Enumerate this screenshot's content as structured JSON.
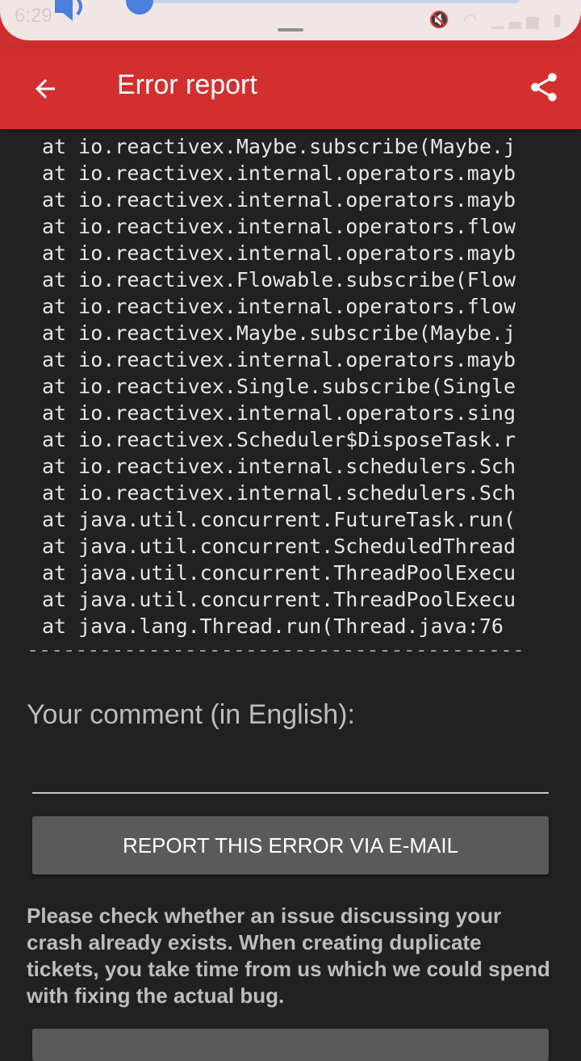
{
  "status_bar": {
    "time": "6:29",
    "volume_level": 0.03
  },
  "app_bar": {
    "title": "Error report",
    "back_icon": "arrow-back-icon",
    "share_icon": "share-icon"
  },
  "stack_trace": {
    "lines": [
      "at io.reactivex.Maybe.subscribe(Maybe.j",
      "at io.reactivex.internal.operators.mayb",
      "at io.reactivex.internal.operators.mayb",
      "at io.reactivex.internal.operators.flow",
      "at io.reactivex.internal.operators.mayb",
      "at io.reactivex.Flowable.subscribe(Flow",
      "at io.reactivex.internal.operators.flow",
      "at io.reactivex.Maybe.subscribe(Maybe.j",
      "at io.reactivex.internal.operators.mayb",
      "at io.reactivex.Single.subscribe(Single",
      "at io.reactivex.internal.operators.sing",
      "at io.reactivex.Scheduler$DisposeTask.r",
      "at io.reactivex.internal.schedulers.Sch",
      "at io.reactivex.internal.schedulers.Sch",
      "at java.util.concurrent.FutureTask.run(",
      "at java.util.concurrent.ScheduledThread",
      "at java.util.concurrent.ThreadPoolExecu",
      "at java.util.concurrent.ThreadPoolExecu",
      "at java.lang.Thread.run(Thread.java:76"
    ],
    "divider": "-----------------------------------------"
  },
  "comment": {
    "label": "Your comment (in English):",
    "value": ""
  },
  "report_button": {
    "label": "REPORT THIS ERROR VIA E-MAIL"
  },
  "notice": {
    "text": "Please check whether an issue discussing your crash already exists. When creating duplicate tickets, you take time from us which we could spend with fixing the actual bug."
  },
  "colors": {
    "app_bar": "#d32f2f",
    "background": "#212121",
    "button": "#5a5a5a"
  }
}
